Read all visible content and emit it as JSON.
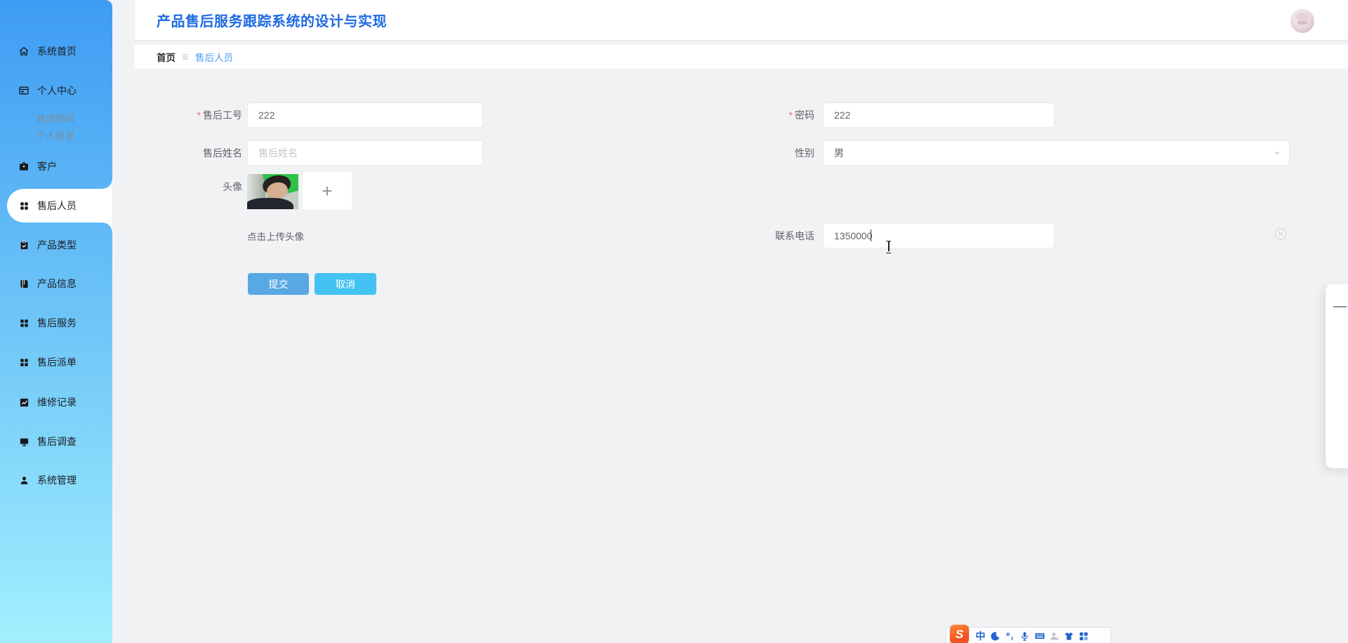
{
  "app": {
    "title": "产品售后服务跟踪系统的设计与实现"
  },
  "breadcrumb": {
    "home": "首页",
    "current": "售后人员"
  },
  "sidebar": {
    "items": [
      {
        "label": "系统首页",
        "icon": "home-icon"
      },
      {
        "label": "个人中心",
        "icon": "idcard-icon"
      },
      {
        "label": "修改密码"
      },
      {
        "label": "个人信息"
      },
      {
        "label": "客户",
        "icon": "briefcase-icon"
      },
      {
        "label": "售后人员",
        "icon": "grid-icon",
        "active": true
      },
      {
        "label": "产品类型",
        "icon": "clipboard-icon"
      },
      {
        "label": "产品信息",
        "icon": "book-icon"
      },
      {
        "label": "售后服务",
        "icon": "grid-icon"
      },
      {
        "label": "售后派单",
        "icon": "grid-icon"
      },
      {
        "label": "维修记录",
        "icon": "chart-icon"
      },
      {
        "label": "售后调查",
        "icon": "monitor-icon"
      },
      {
        "label": "系统管理",
        "icon": "user-icon"
      }
    ]
  },
  "form": {
    "worker_id": {
      "label": "售后工号",
      "required": "*",
      "value": "222"
    },
    "password": {
      "label": "密码",
      "required": "*",
      "value": "222"
    },
    "name": {
      "label": "售后姓名",
      "placeholder": "售后姓名"
    },
    "gender": {
      "label": "性别",
      "value": "男"
    },
    "avatar": {
      "label": "头像",
      "add": "+",
      "hint": "点击上传头像"
    },
    "phone": {
      "label": "联系电话",
      "value": "1350000"
    },
    "submit_label": "提交",
    "cancel_label": "取消"
  },
  "ime": {
    "logo": "S",
    "mode_cn": "中",
    "status_letter": "N"
  },
  "colors": {
    "title_blue": "#1e6ae3",
    "breadcrumb_link": "#4a9ff2",
    "submit_btn": "#57a8e3",
    "cancel_btn": "#44c3f2",
    "sidebar_gradient_top": "#3e9cf3",
    "sidebar_gradient_bottom": "#a2f0fe",
    "required_star": "#f56c6c"
  }
}
